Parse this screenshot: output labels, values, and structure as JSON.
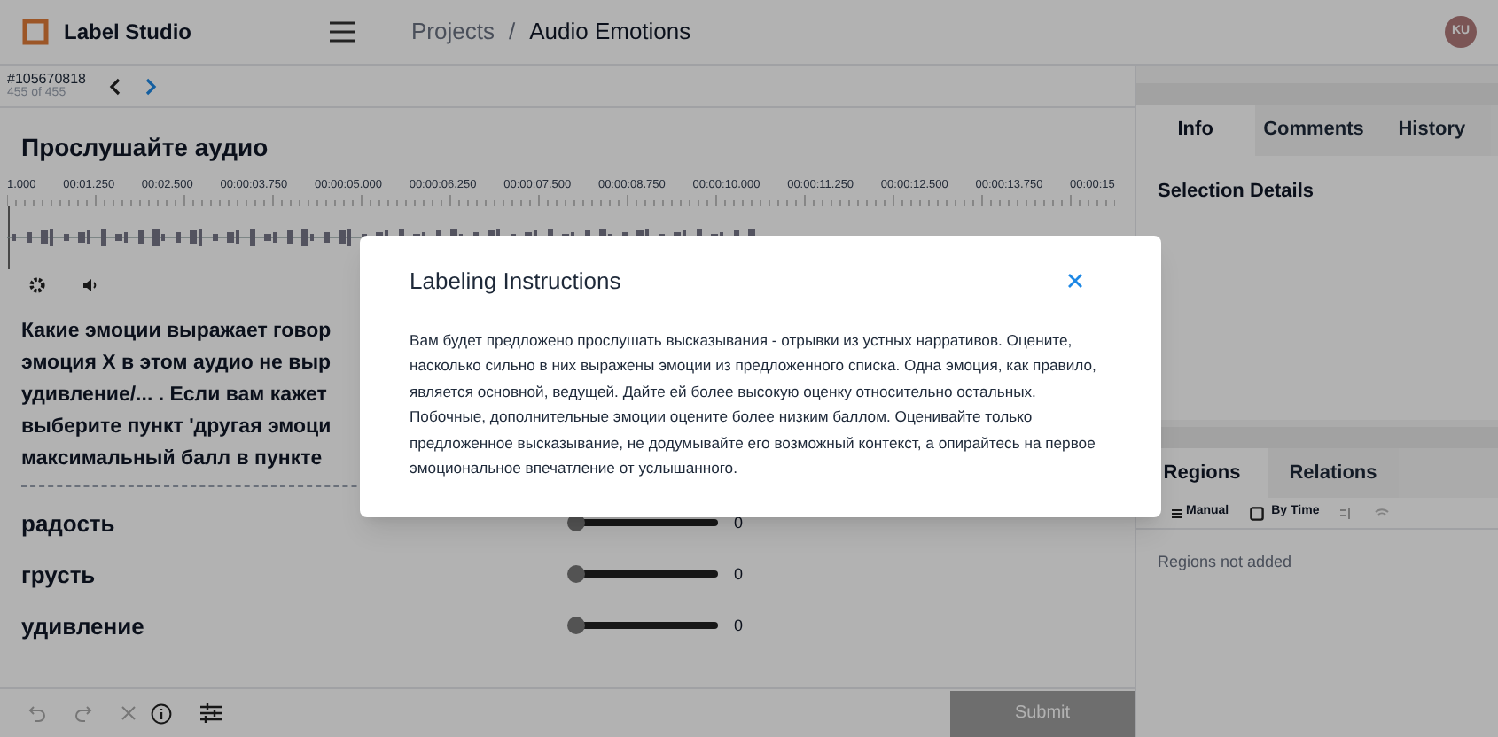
{
  "header": {
    "app_name": "Label Studio",
    "breadcrumb_separator": "/",
    "breadcrumbs": [
      {
        "label": "Projects",
        "current": false
      },
      {
        "label": "Audio Emotions",
        "current": true
      }
    ],
    "avatar": "KU"
  },
  "task": {
    "id": "#105670818",
    "position": "455 of 455"
  },
  "audio": {
    "title": "Прослушайте аудио",
    "ticks": [
      "1.000",
      "00:01.250",
      "00:02.500",
      "00:00:03.750",
      "00:00:05.000",
      "00:00:06.250",
      "00:00:07.500",
      "00:00:08.750",
      "00:00:10.000",
      "00:00:11.250",
      "00:00:12.500",
      "00:00:13.750",
      "00:00:15"
    ]
  },
  "question_lines": [
    "Какие эмоции выражает говор",
    "эмоция X в этом аудио не выр",
    "удивление/... . Если вам кажет",
    "выберите пункт 'другая эмоци",
    "максимальный балл в пункте"
  ],
  "emotions": [
    {
      "label": "радость",
      "level": 0,
      "value": "0"
    },
    {
      "label": "грусть",
      "level": 0,
      "value": "0"
    },
    {
      "label": "удивление",
      "level": 0,
      "value": "0"
    }
  ],
  "toolbar": {
    "submit": "Submit"
  },
  "info_panel": {
    "tabs": [
      {
        "label": "Info",
        "selected": true
      },
      {
        "label": "Comments",
        "selected": false
      },
      {
        "label": "History",
        "selected": false
      }
    ],
    "heading": "Selection Details"
  },
  "regions_panel": {
    "tabs": [
      {
        "label": "Regions",
        "selected": true
      },
      {
        "label": "Relations",
        "selected": false
      }
    ],
    "manual": "Manual",
    "by_time": "By Time",
    "empty": "Regions not added"
  },
  "modal": {
    "title": "Labeling Instructions",
    "body": "Вам будет предложено прослушать высказывания - отрывки из устных нарративов. Оцените, насколько сильно в них выражены эмоции из предложенного списка. Одна эмоция, как правило, является основной, ведущей. Дайте ей более высокую оценку относительно остальных. Побочные, дополнительные эмоции оцените более низким баллом. Оценивайте только предложенное высказывание, не додумывайте его возможный контекст, а опирайтесь на первое эмоциональное впечатление от услышанного."
  }
}
